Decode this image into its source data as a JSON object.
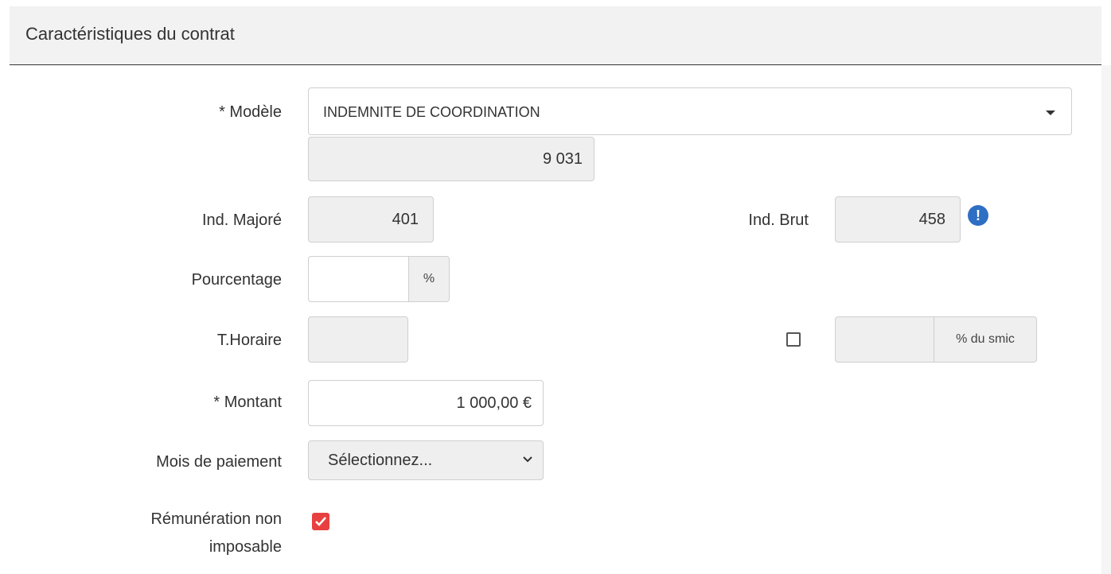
{
  "panel": {
    "title": "Caractéristiques du contrat"
  },
  "fields": {
    "modele": {
      "label": "* Modèle",
      "value": "INDEMNITE DE COORDINATION"
    },
    "code": {
      "value": "9 031"
    },
    "ind_majore": {
      "label": "Ind. Majoré",
      "value": "401"
    },
    "ind_brut": {
      "label": "Ind. Brut",
      "value": "458",
      "icon": "info-icon"
    },
    "pourcentage": {
      "label": "Pourcentage",
      "value": "",
      "addon": "%"
    },
    "t_horaire": {
      "label": "T.Horaire",
      "value": ""
    },
    "smic": {
      "value": "",
      "addon": "% du smic",
      "checked": false
    },
    "montant": {
      "label": "* Montant",
      "value": "1 000,00 €"
    },
    "mois_paiement": {
      "label": "Mois de paiement",
      "selected": "Sélectionnez..."
    },
    "remuneration": {
      "label_line1": "Rémunération non",
      "label_line2": "imposable",
      "checked": true
    }
  },
  "colors": {
    "checkbox_accent": "#e84040",
    "info_icon": "#2e6fc4"
  }
}
